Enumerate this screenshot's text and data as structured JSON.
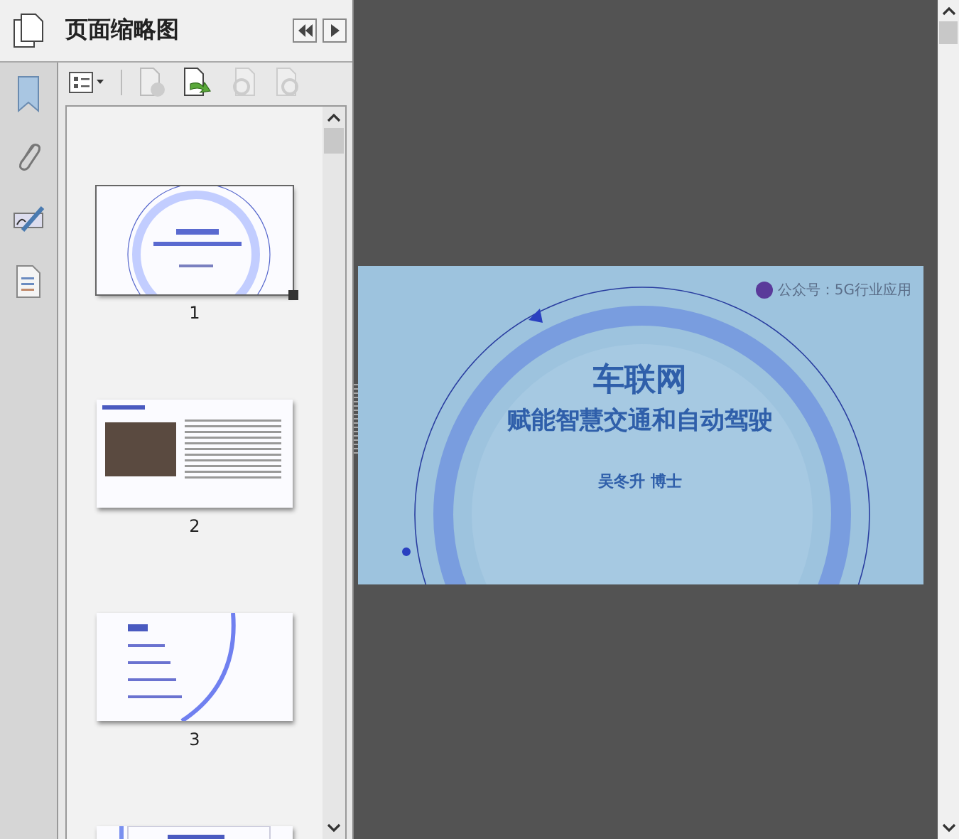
{
  "panel": {
    "title": "页面缩略图"
  },
  "thumbnails": [
    {
      "page": "1",
      "kind": "cover",
      "selected": true
    },
    {
      "page": "2",
      "kind": "profile",
      "selected": false
    },
    {
      "page": "3",
      "kind": "contents",
      "selected": false
    },
    {
      "kind": "section",
      "selected": false
    }
  ],
  "slide": {
    "brand": "公众号：5G行业应用",
    "title": "车联网",
    "subtitle": "赋能智慧交通和自动驾驶",
    "author": "吴冬升 博士"
  }
}
